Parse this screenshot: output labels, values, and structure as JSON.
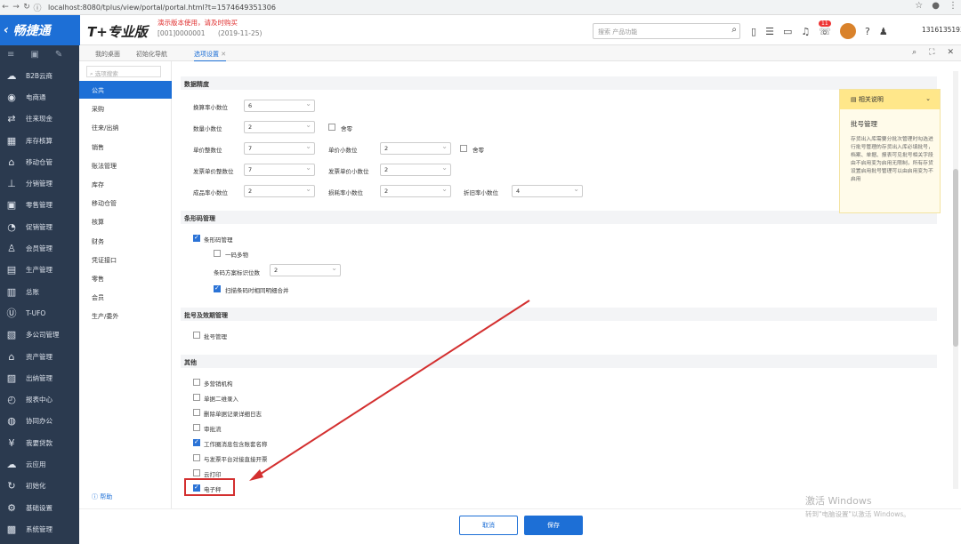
{
  "browser": {
    "url": "localhost:8080/tplus/view/portal/portal.html?t=1574649351306"
  },
  "header": {
    "logo": "畅捷通",
    "product": "T+专业版",
    "notice": "演示版本使用，请及时购买",
    "account": "[001]0000001",
    "date": "(2019-11-25)",
    "search_placeholder": "搜索 产品功能",
    "badge": "11",
    "phone": "13161351931"
  },
  "sidebar": {
    "items": [
      {
        "label": "B2B云商",
        "icon": "cloud-shop-icon"
      },
      {
        "label": "电商通",
        "icon": "ecommerce-icon"
      },
      {
        "label": "往来现金",
        "icon": "cash-icon"
      },
      {
        "label": "库存核算",
        "icon": "inventory-icon"
      },
      {
        "label": "移动仓管",
        "icon": "mobile-warehouse-icon"
      },
      {
        "label": "分销管理",
        "icon": "distribution-icon"
      },
      {
        "label": "零售管理",
        "icon": "retail-icon"
      },
      {
        "label": "促销管理",
        "icon": "promotion-icon"
      },
      {
        "label": "会员管理",
        "icon": "member-icon"
      },
      {
        "label": "生产管理",
        "icon": "production-icon"
      },
      {
        "label": "总账",
        "icon": "ledger-icon"
      },
      {
        "label": "T-UFO",
        "icon": "ufo-icon"
      },
      {
        "label": "多公司管理",
        "icon": "multi-company-icon"
      },
      {
        "label": "资产管理",
        "icon": "asset-icon"
      },
      {
        "label": "出纳管理",
        "icon": "cashier-icon"
      },
      {
        "label": "报表中心",
        "icon": "report-icon"
      },
      {
        "label": "协同办公",
        "icon": "collab-icon"
      },
      {
        "label": "我要贷款",
        "icon": "loan-icon"
      },
      {
        "label": "云应用",
        "icon": "cloud-app-icon"
      },
      {
        "label": "初始化",
        "icon": "init-icon"
      },
      {
        "label": "基础设置",
        "icon": "basic-settings-icon"
      },
      {
        "label": "系统管理",
        "icon": "system-icon"
      }
    ]
  },
  "tabs": [
    {
      "label": "我的桌面"
    },
    {
      "label": "初始化导航"
    },
    {
      "label": "选项设置"
    }
  ],
  "catnav": {
    "search_placeholder": "选项搜索",
    "items": [
      "公共",
      "采购",
      "往来/出纳",
      "销售",
      "账法管理",
      "库存",
      "移动仓管",
      "核算",
      "财务",
      "凭证接口",
      "零售",
      "会员",
      "生产/委外"
    ],
    "help": "帮助"
  },
  "sections": {
    "precision": {
      "title": "数据精度",
      "qty_convert": {
        "label": "换算率小数位",
        "value": "6"
      },
      "qty_decimals": {
        "label": "数量小数位",
        "value": "2"
      },
      "round": "舍零",
      "unit_price_int": {
        "label": "单价整数位",
        "value": "7"
      },
      "unit_price_dec": {
        "label": "单价小数位",
        "value": "2"
      },
      "round2": "舍零",
      "invoice_price_int": {
        "label": "发票单价整数位",
        "value": "7"
      },
      "invoice_price_dec": {
        "label": "发票单价小数位",
        "value": "2"
      },
      "cost_dec": {
        "label": "成品率小数位",
        "value": "2"
      },
      "loss_dec": {
        "label": "损耗率小数位",
        "value": "2"
      },
      "depr_dec": {
        "label": "折旧率小数位",
        "value": "4"
      }
    },
    "barcode": {
      "title": "条形码管理",
      "enabled": "条形码管理",
      "multi": "一码多物",
      "digits": {
        "label": "条码方案标识位数",
        "value": "2"
      },
      "merge": "扫描条码时相同明细合并"
    },
    "batch": {
      "title": "批号及效期管理",
      "batch": "批号管理"
    },
    "other": {
      "title": "其他",
      "items": [
        {
          "label": "多营销机构",
          "checked": false
        },
        {
          "label": "单据二维录入",
          "checked": false
        },
        {
          "label": "删除单据记录详细日志",
          "checked": false
        },
        {
          "label": "审批流",
          "checked": false
        },
        {
          "label": "工作圈消息包含账套名称",
          "checked": true
        },
        {
          "label": "与发票平台对接直接开票",
          "checked": false
        },
        {
          "label": "云打印",
          "checked": false
        },
        {
          "label": "电子秤",
          "checked": true
        }
      ]
    }
  },
  "panel": {
    "header": "相关说明",
    "title": "批号管理",
    "text": "存货出入库需要分批次管理时勾选进行批号管理的存货出入库必填批号，档案、单据、报表可见批号相关字段由不启用变为启用无限制，所有存货设置启用批号管理可以由启用变为不启用"
  },
  "footer": {
    "cancel": "取消",
    "save": "保存"
  },
  "watermark": {
    "line1": "激活 Windows",
    "line2": "转到\"电脑设置\"以激活 Windows。"
  },
  "colors": {
    "accent": "#1d6fd6",
    "sidebar": "#2b3a4f",
    "highlight": "#d32f2f"
  }
}
